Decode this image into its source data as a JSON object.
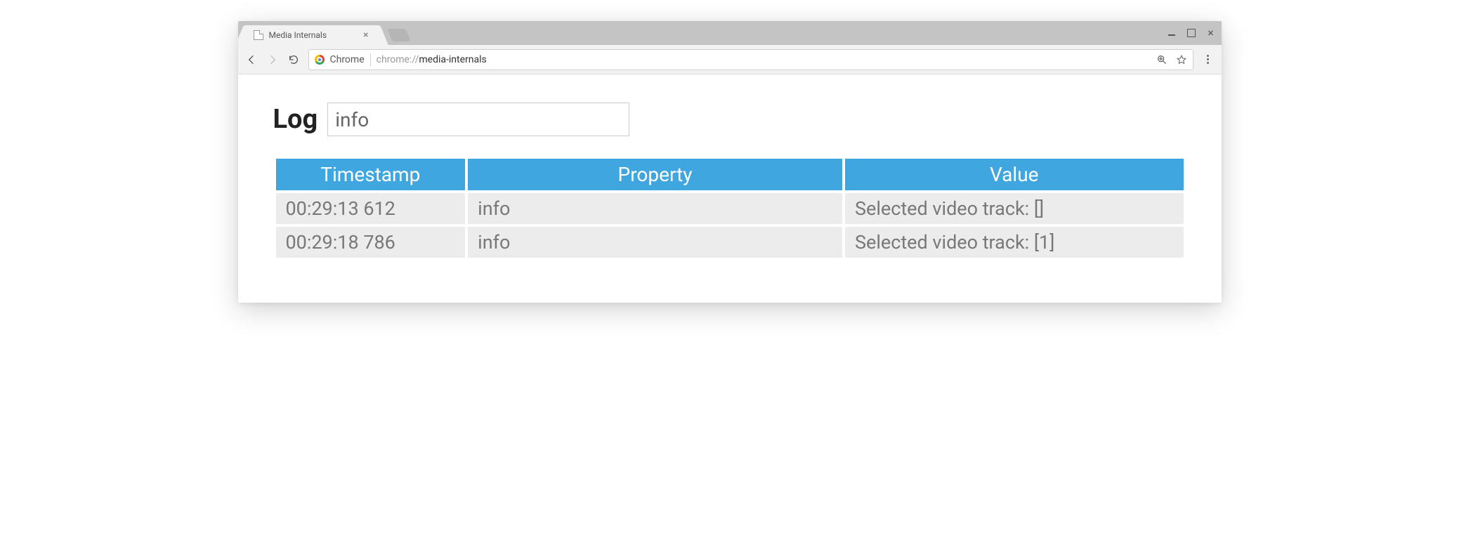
{
  "browser": {
    "tab_title": "Media Internals",
    "origin_label": "Chrome",
    "url_scheme": "chrome://",
    "url_path": "media-internals"
  },
  "page": {
    "heading": "Log",
    "filter_value": "info"
  },
  "table": {
    "headers": {
      "timestamp": "Timestamp",
      "property": "Property",
      "value": "Value"
    },
    "rows": [
      {
        "timestamp": "00:29:13 612",
        "property": "info",
        "value": "Selected video track: []"
      },
      {
        "timestamp": "00:29:18 786",
        "property": "info",
        "value": "Selected video track: [1]"
      }
    ]
  }
}
